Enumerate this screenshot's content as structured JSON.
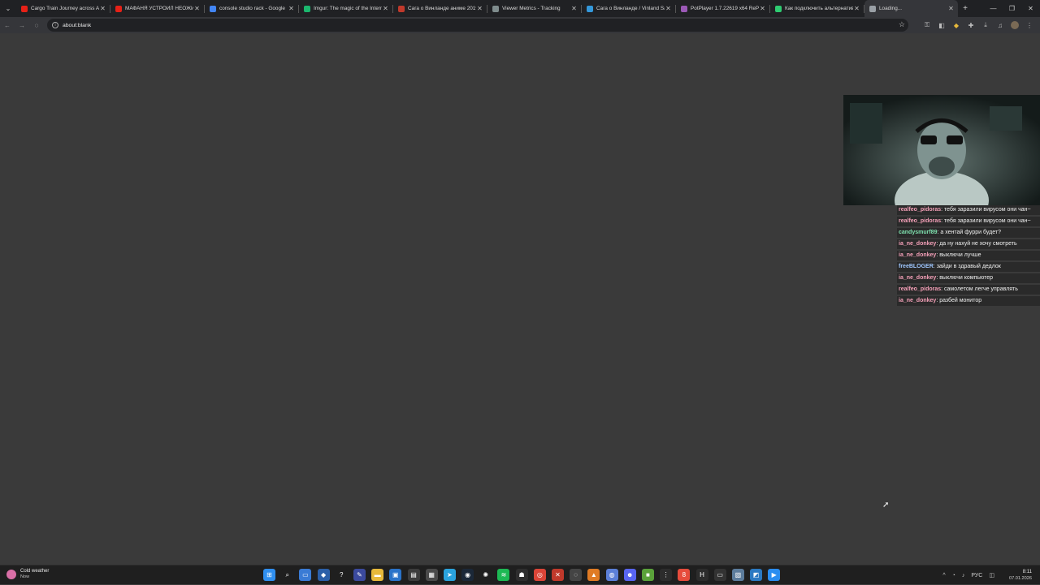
{
  "tabs": [
    {
      "title": "Cargo Train Journey across Am",
      "icon": "youtube-icon",
      "color": "#e62117"
    },
    {
      "title": "МАФАНЯ УСТРОИЛ НЕОЖИДАН",
      "icon": "youtube-icon",
      "color": "#e62117"
    },
    {
      "title": "console studio rack - Google",
      "icon": "google-icon",
      "color": "#4285f4"
    },
    {
      "title": "Imgur: The magic of the Intern",
      "icon": "imgur-icon",
      "color": "#1bb76e"
    },
    {
      "title": "Сага о Винланде аниме 2019",
      "icon": "site-icon",
      "color": "#c0392b"
    },
    {
      "title": "Viewer Metrics - Tracking",
      "icon": "metrics-icon",
      "color": "#7f8c8d"
    },
    {
      "title": "Сага о Винланде / Vinland Sa",
      "icon": "site-icon",
      "color": "#3498db"
    },
    {
      "title": "PotPlayer 1.7.22619 x64 RePa",
      "icon": "potplayer-icon",
      "color": "#9b59b6"
    },
    {
      "title": "Как подключить альтернатив",
      "icon": "site-icon",
      "color": "#2ecc71"
    },
    {
      "title": "Loading...",
      "icon": "loading-icon",
      "color": "#9aa0a6"
    }
  ],
  "toolbar": {
    "url": "about:blank"
  },
  "chat": [
    {
      "user": "realfeo_pidoras",
      "text": "тебя заразили вирусом они чан~",
      "color": "#f4a0b8"
    },
    {
      "user": "realfeo_pidoras",
      "text": "тебя заразили вирусом они чан~",
      "color": "#f4a0b8"
    },
    {
      "user": "candysmurf89",
      "text": "а хентай фурри будет?",
      "color": "#7fe3b0"
    },
    {
      "user": "ia_ne_donkey",
      "text": "да ну нахуй не хочу смотреть",
      "color": "#f4a0b8"
    },
    {
      "user": "ia_ne_donkey",
      "text": "выключи лучше",
      "color": "#f4a0b8"
    },
    {
      "user": "freeBLOGER",
      "text": "зайди в здравый дедлок",
      "color": "#9fc7ff"
    },
    {
      "user": "ia_ne_donkey",
      "text": "выключи компьютер",
      "color": "#f4a0b8"
    },
    {
      "user": "realfeo_pidoras",
      "text": "самолетом легче управлять",
      "color": "#f4a0b8"
    },
    {
      "user": "ia_ne_donkey",
      "text": "разбей монитор",
      "color": "#f4a0b8"
    }
  ],
  "taskbar": {
    "weather_title": "Cold weather",
    "weather_sub": "Now",
    "apps": [
      {
        "name": "start-icon",
        "color": "#2f8ff0",
        "glyph": "⊞"
      },
      {
        "name": "search-icon",
        "color": "#1f1f1f",
        "glyph": "⌕"
      },
      {
        "name": "task-view-icon",
        "color": "#3a7bd5",
        "glyph": "▭"
      },
      {
        "name": "app-icon",
        "color": "#2b5fa8",
        "glyph": "◆"
      },
      {
        "name": "app-icon",
        "color": "#1f1f1f",
        "glyph": "?"
      },
      {
        "name": "app-icon",
        "color": "#3b4a9e",
        "glyph": "✎"
      },
      {
        "name": "file-explorer-icon",
        "color": "#e7b93b",
        "glyph": "▬"
      },
      {
        "name": "app-icon",
        "color": "#2a73c9",
        "glyph": "▣"
      },
      {
        "name": "app-icon",
        "color": "#3c3c3c",
        "glyph": "▤"
      },
      {
        "name": "app-icon",
        "color": "#4a4a4a",
        "glyph": "▦"
      },
      {
        "name": "telegram-icon",
        "color": "#2aa3dd",
        "glyph": "➤"
      },
      {
        "name": "steam-icon",
        "color": "#1b2838",
        "glyph": "◉"
      },
      {
        "name": "chatgpt-icon",
        "color": "#1f1f1f",
        "glyph": "✺"
      },
      {
        "name": "spotify-icon",
        "color": "#1db954",
        "glyph": "≋"
      },
      {
        "name": "app-icon",
        "color": "#2e2e2e",
        "glyph": "☗"
      },
      {
        "name": "chrome-icon",
        "color": "#db4437",
        "glyph": "◎"
      },
      {
        "name": "app-icon",
        "color": "#c0392b",
        "glyph": "✕"
      },
      {
        "name": "app-icon",
        "color": "#444",
        "glyph": "◌"
      },
      {
        "name": "app-icon",
        "color": "#e07b24",
        "glyph": "▲"
      },
      {
        "name": "app-icon",
        "color": "#5b7fd8",
        "glyph": "◍"
      },
      {
        "name": "discord-icon",
        "color": "#5865f2",
        "glyph": "☻"
      },
      {
        "name": "minecraft-icon",
        "color": "#5aa23a",
        "glyph": "■"
      },
      {
        "name": "app-icon",
        "color": "#2c2c2c",
        "glyph": "⋮"
      },
      {
        "name": "app-icon",
        "color": "#e74c3c",
        "glyph": "8"
      },
      {
        "name": "app-icon",
        "color": "#2c2c2c",
        "glyph": "H"
      },
      {
        "name": "terminal-icon",
        "color": "#333",
        "glyph": "▭"
      },
      {
        "name": "app-icon",
        "color": "#5c7c9c",
        "glyph": "▧"
      },
      {
        "name": "app-icon",
        "color": "#2b79c2",
        "glyph": "◩"
      },
      {
        "name": "app-icon",
        "color": "#2a8df0",
        "glyph": "▶"
      }
    ],
    "lang": "РУС",
    "time": "8:11",
    "date": "07.01.2026"
  }
}
